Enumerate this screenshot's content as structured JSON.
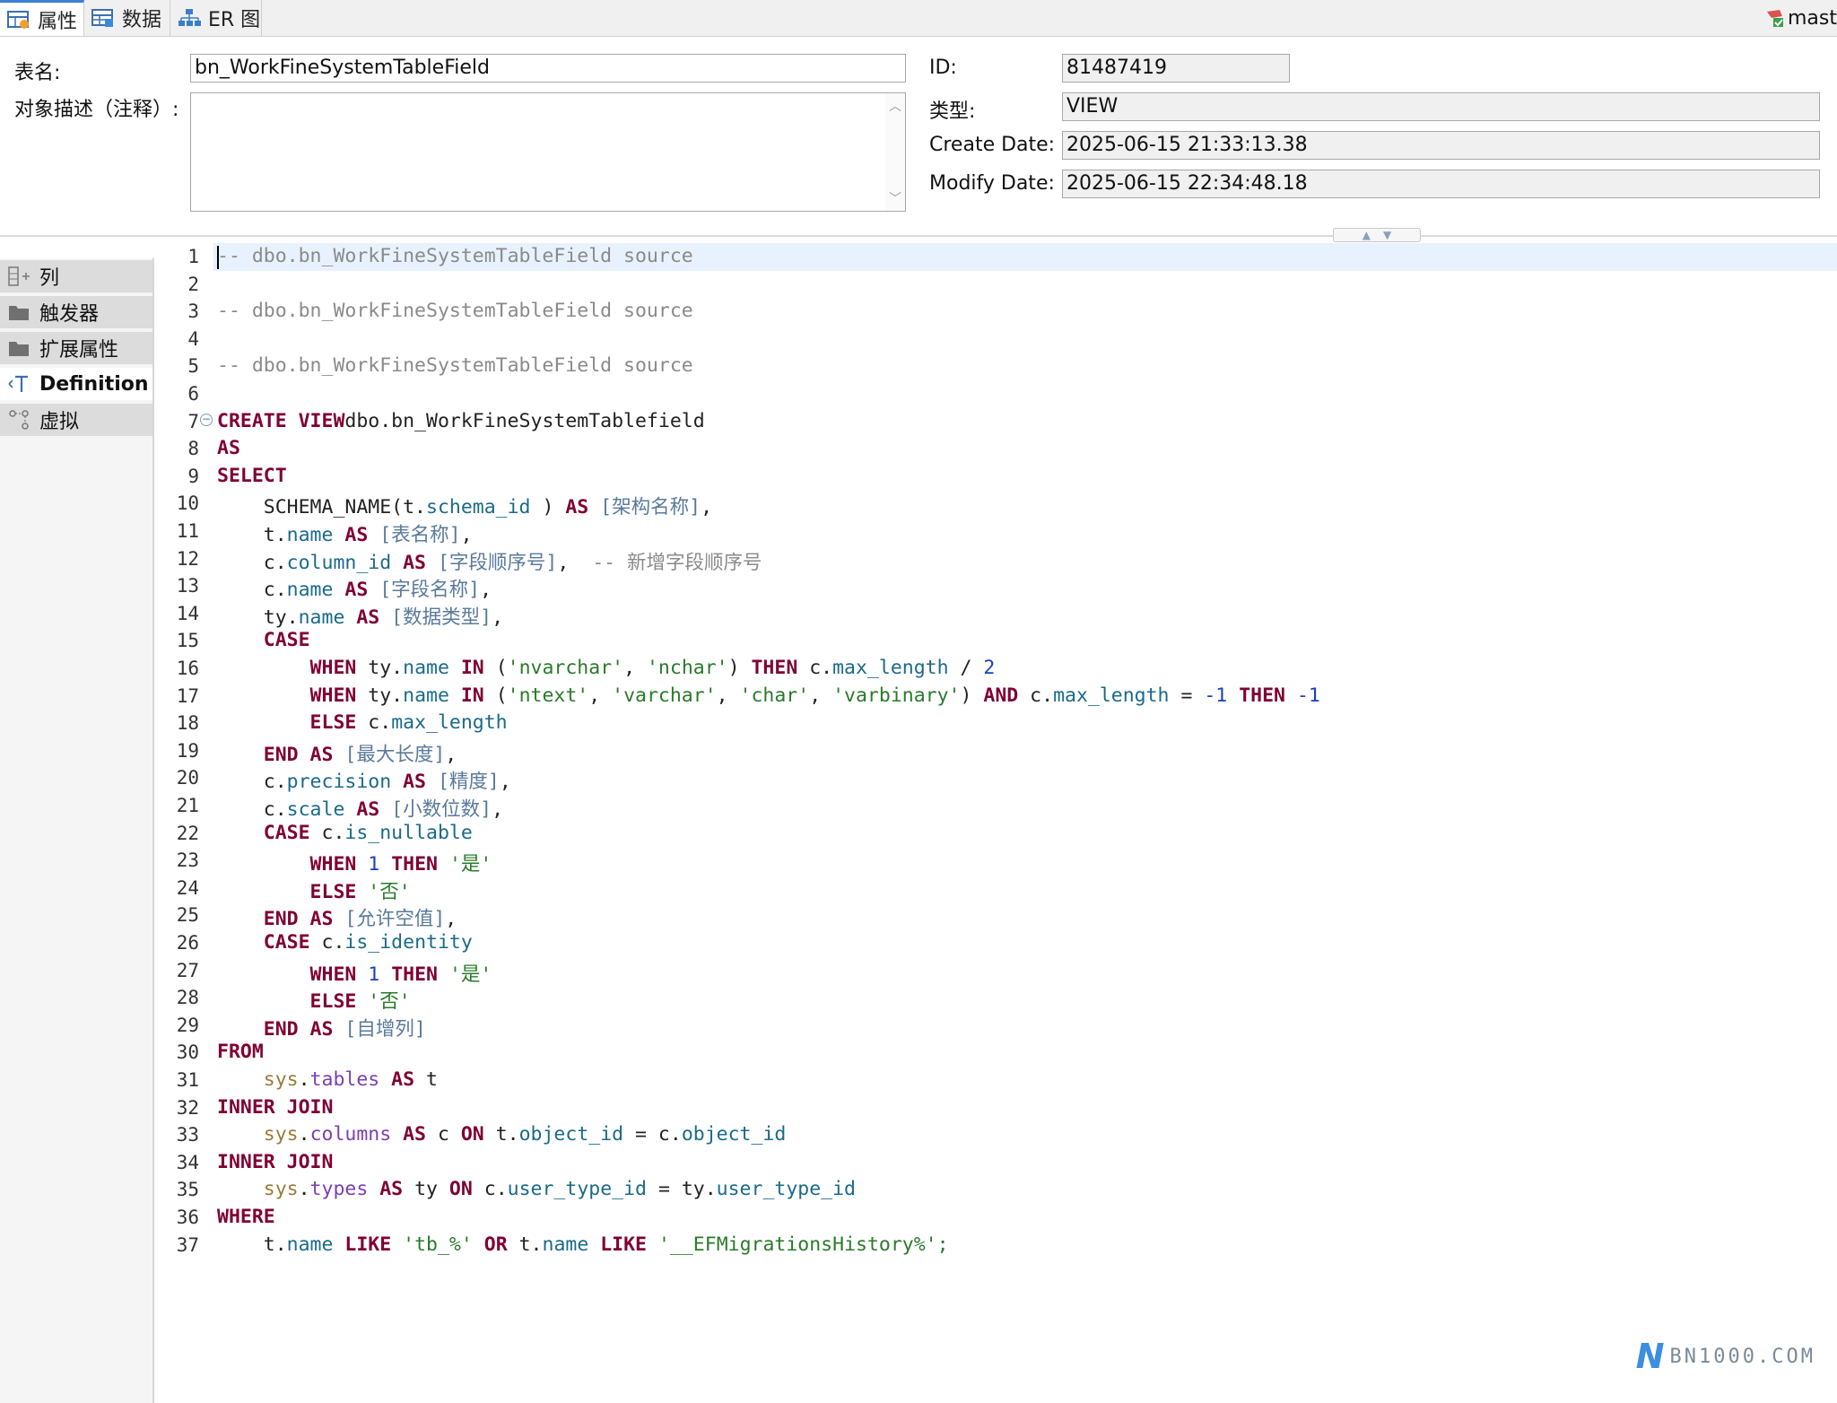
{
  "tabs": [
    {
      "label": "属性",
      "icon": "table-props-icon",
      "active": true
    },
    {
      "label": "数据",
      "icon": "table-data-icon",
      "active": false
    },
    {
      "label": "ER 图",
      "icon": "er-diagram-icon",
      "active": false
    }
  ],
  "connection": {
    "label": "mast",
    "icon": "connection-status-icon"
  },
  "form": {
    "table_name_label": "表名:",
    "table_name_value": "bn_WorkFineSystemTableField",
    "description_label": "对象描述（注释）:",
    "description_value": "",
    "id_label": "ID:",
    "id_value": "81487419",
    "type_label": "类型:",
    "type_value": "VIEW",
    "create_date_label": "Create Date:",
    "create_date_value": "2025-06-15 21:33:13.38",
    "modify_date_label": "Modify Date:",
    "modify_date_value": "2025-06-15 22:34:48.18"
  },
  "nav": [
    {
      "label": "列",
      "icon": "columns-icon",
      "active": false
    },
    {
      "label": "触发器",
      "icon": "folder-icon",
      "active": false
    },
    {
      "label": "扩展属性",
      "icon": "folder-icon",
      "active": false
    },
    {
      "label": "Definition",
      "icon": "definition-icon",
      "active": true
    },
    {
      "label": "虚拟",
      "icon": "virtual-relation-icon",
      "active": false
    }
  ],
  "editor": {
    "lines": [
      [
        [
          "cm",
          "-- dbo.bn_WorkFineSystemTableField source"
        ]
      ],
      [],
      [
        [
          "cm",
          "-- dbo.bn_WorkFineSystemTableField source"
        ]
      ],
      [],
      [
        [
          "cm",
          "-- dbo.bn_WorkFineSystemTableField source"
        ]
      ],
      [],
      [
        [
          "kw",
          "CREATE VIEW"
        ],
        [
          "",
          "dbo.bn_WorkFineSystemTablefield"
        ]
      ],
      [
        [
          "kw",
          "AS"
        ]
      ],
      [
        [
          "kw",
          "SELECT"
        ]
      ],
      [
        [
          "",
          "    SCHEMA_NAME(t."
        ],
        [
          "fn",
          "schema_id"
        ],
        [
          "",
          " ) "
        ],
        [
          "kw",
          "AS"
        ],
        [
          "br",
          " [架构名称]"
        ],
        [
          "",
          ","
        ]
      ],
      [
        [
          "",
          "    t."
        ],
        [
          "fn",
          "name"
        ],
        [
          "",
          ""
        ],
        [
          "kw",
          " AS"
        ],
        [
          "br",
          " [表名称]"
        ],
        [
          "",
          ","
        ]
      ],
      [
        [
          "",
          "    c."
        ],
        [
          "fn",
          "column_id"
        ],
        [
          "kw",
          " AS"
        ],
        [
          "br",
          " [字段顺序号]"
        ],
        [
          "",
          ",  "
        ],
        [
          "cm",
          "-- 新增字段顺序号"
        ]
      ],
      [
        [
          "",
          "    c."
        ],
        [
          "fn",
          "name"
        ],
        [
          "kw",
          " AS"
        ],
        [
          "br",
          " [字段名称]"
        ],
        [
          "",
          ","
        ]
      ],
      [
        [
          "",
          "    ty."
        ],
        [
          "fn",
          "name"
        ],
        [
          "kw",
          " AS"
        ],
        [
          "br",
          " [数据类型]"
        ],
        [
          "",
          ","
        ]
      ],
      [
        [
          "kw",
          "    CASE"
        ]
      ],
      [
        [
          "kw",
          "        WHEN"
        ],
        [
          "",
          " ty."
        ],
        [
          "fn",
          "name"
        ],
        [
          "kw",
          " IN"
        ],
        [
          "",
          " ("
        ],
        [
          "st",
          "'nvarchar'"
        ],
        [
          "",
          ", "
        ],
        [
          "st",
          "'nchar'"
        ],
        [
          "",
          ") "
        ],
        [
          "kw",
          "THEN"
        ],
        [
          "",
          " c."
        ],
        [
          "fn",
          "max_length"
        ],
        [
          "",
          " / "
        ],
        [
          "nu",
          "2"
        ]
      ],
      [
        [
          "kw",
          "        WHEN"
        ],
        [
          "",
          " ty."
        ],
        [
          "fn",
          "name"
        ],
        [
          "kw",
          " IN"
        ],
        [
          "",
          " ("
        ],
        [
          "st",
          "'ntext'"
        ],
        [
          "",
          ", "
        ],
        [
          "st",
          "'varchar'"
        ],
        [
          "",
          ", "
        ],
        [
          "st",
          "'char'"
        ],
        [
          "",
          ", "
        ],
        [
          "st",
          "'varbinary'"
        ],
        [
          "",
          ") "
        ],
        [
          "kw",
          "AND"
        ],
        [
          "",
          " c."
        ],
        [
          "fn",
          "max_length"
        ],
        [
          "",
          " = "
        ],
        [
          "nu",
          "-1"
        ],
        [
          "kw",
          " THEN"
        ],
        [
          "",
          " "
        ],
        [
          "nu",
          "-1"
        ]
      ],
      [
        [
          "kw",
          "        ELSE"
        ],
        [
          "",
          " c."
        ],
        [
          "fn",
          "max_length"
        ]
      ],
      [
        [
          "kw",
          "    END AS"
        ],
        [
          "br",
          " [最大长度]"
        ],
        [
          "",
          ","
        ]
      ],
      [
        [
          "",
          "    c."
        ],
        [
          "fn",
          "precision"
        ],
        [
          "kw",
          " AS"
        ],
        [
          "br",
          " [精度]"
        ],
        [
          "",
          ","
        ]
      ],
      [
        [
          "",
          "    c."
        ],
        [
          "fn",
          "scale"
        ],
        [
          "kw",
          " AS"
        ],
        [
          "br",
          " [小数位数]"
        ],
        [
          "",
          ","
        ]
      ],
      [
        [
          "kw",
          "    CASE"
        ],
        [
          "",
          " c."
        ],
        [
          "fn",
          "is_nullable"
        ]
      ],
      [
        [
          "kw",
          "        WHEN"
        ],
        [
          "",
          " "
        ],
        [
          "nu",
          "1"
        ],
        [
          "kw",
          " THEN"
        ],
        [
          "",
          " "
        ],
        [
          "st",
          "'是'"
        ]
      ],
      [
        [
          "kw",
          "        ELSE"
        ],
        [
          "",
          " "
        ],
        [
          "st",
          "'否'"
        ]
      ],
      [
        [
          "kw",
          "    END AS"
        ],
        [
          "br",
          " [允许空值]"
        ],
        [
          "",
          ","
        ]
      ],
      [
        [
          "kw",
          "    CASE"
        ],
        [
          "",
          " c."
        ],
        [
          "fn",
          "is_identity"
        ]
      ],
      [
        [
          "kw",
          "        WHEN"
        ],
        [
          "",
          " "
        ],
        [
          "nu",
          "1"
        ],
        [
          "kw",
          " THEN"
        ],
        [
          "",
          " "
        ],
        [
          "st",
          "'是'"
        ]
      ],
      [
        [
          "kw",
          "        ELSE"
        ],
        [
          "",
          " "
        ],
        [
          "st",
          "'否'"
        ]
      ],
      [
        [
          "kw",
          "    END AS"
        ],
        [
          "br",
          " [自增列]"
        ]
      ],
      [
        [
          "kw",
          "FROM"
        ]
      ],
      [
        [
          "sy",
          "    sys"
        ],
        [
          "",
          "."
        ],
        [
          "ttt",
          "tables"
        ],
        [
          "kw",
          " AS"
        ],
        [
          "",
          " t"
        ]
      ],
      [
        [
          "kw",
          "INNER JOIN"
        ]
      ],
      [
        [
          "sy",
          "    sys"
        ],
        [
          "",
          "."
        ],
        [
          "ttt",
          "columns"
        ],
        [
          "kw",
          " AS"
        ],
        [
          "",
          " c "
        ],
        [
          "kw",
          "ON"
        ],
        [
          "",
          " t."
        ],
        [
          "fn",
          "object_id"
        ],
        [
          "",
          " = c."
        ],
        [
          "fn",
          "object_id"
        ]
      ],
      [
        [
          "kw",
          "INNER JOIN"
        ]
      ],
      [
        [
          "sy",
          "    sys"
        ],
        [
          "",
          "."
        ],
        [
          "ttt",
          "types"
        ],
        [
          "kw",
          " AS"
        ],
        [
          "",
          " ty "
        ],
        [
          "kw",
          "ON"
        ],
        [
          "",
          " c."
        ],
        [
          "fn",
          "user_type_id"
        ],
        [
          "",
          " = ty."
        ],
        [
          "fn",
          "user_type_id"
        ]
      ],
      [
        [
          "kw",
          "WHERE"
        ]
      ],
      [
        [
          "",
          "    t."
        ],
        [
          "fn",
          "name"
        ],
        [
          "kw",
          " LIKE"
        ],
        [
          "",
          " "
        ],
        [
          "st",
          "'tb_%'"
        ],
        [
          "kw",
          " OR"
        ],
        [
          "",
          " t."
        ],
        [
          "fn",
          "name"
        ],
        [
          "kw",
          " LIKE"
        ],
        [
          "",
          " "
        ],
        [
          "st",
          "'__EFMigrationsHistory%'"
        ],
        [
          "st",
          ";"
        ]
      ]
    ]
  },
  "watermark": {
    "mark": "N",
    "text": "BN1000.COM"
  }
}
